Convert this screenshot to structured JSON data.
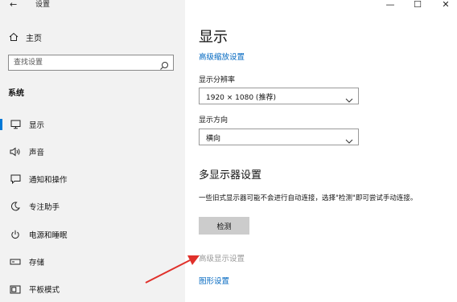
{
  "window": {
    "title": "设置",
    "back_icon": "←",
    "minimize_icon": "—",
    "maximize_icon": "☐",
    "close_icon": "✕"
  },
  "sidebar": {
    "home_label": "主页",
    "search_placeholder": "查找设置",
    "section_label": "系统",
    "items": [
      {
        "label": "显示",
        "icon": "monitor-icon",
        "active": true
      },
      {
        "label": "声音",
        "icon": "speaker-icon",
        "active": false
      },
      {
        "label": "通知和操作",
        "icon": "notification-icon",
        "active": false
      },
      {
        "label": "专注助手",
        "icon": "moon-icon",
        "active": false
      },
      {
        "label": "电源和睡眠",
        "icon": "power-icon",
        "active": false
      },
      {
        "label": "存储",
        "icon": "storage-icon",
        "active": false
      },
      {
        "label": "平板模式",
        "icon": "tablet-icon",
        "active": false
      }
    ]
  },
  "main": {
    "title": "显示",
    "advanced_scaling_link": "高级缩放设置",
    "resolution_label": "显示分辨率",
    "resolution_value": "1920 × 1080 (推荐)",
    "orientation_label": "显示方向",
    "orientation_value": "横向",
    "multi_display_heading": "多显示器设置",
    "multi_display_desc": "一些旧式显示器可能不会进行自动连接，选择\"检测\"即可尝试手动连接。",
    "detect_button": "检测",
    "advanced_display_link": "高级显示设置",
    "graphics_settings_link": "图形设置"
  },
  "colors": {
    "accent": "#0078d7",
    "link": "#0067c0",
    "annotation_arrow": "#e0302a"
  }
}
